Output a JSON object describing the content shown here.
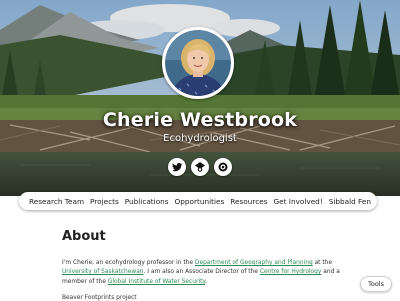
{
  "profile": {
    "name": "Cherie Westbrook",
    "title": "Ecohydrologist"
  },
  "social_links": [
    {
      "icon": "twitter-bird-icon"
    },
    {
      "icon": "google-scholar-icon"
    },
    {
      "icon": "researchgate-icon"
    }
  ],
  "nav": {
    "items": [
      "Research Team",
      "Projects",
      "Publications",
      "Opportunities",
      "Resources",
      "Get Involved!",
      "Sibbald Fen"
    ]
  },
  "about": {
    "heading": "About",
    "intro": "I'm Cherie, an ecohydrology professor in the ",
    "link_department": "Department of Geography and Planning",
    "at_the": " at the ",
    "link_university": "University of Saskatchewan",
    "associate": ". I am also an Associate Director of the ",
    "link_centre": "Centre for Hydrology",
    "member": " and a member of the ",
    "link_gwf": "Global Institute of Water Security",
    "period": ".",
    "next_line": "Beaver Footprints project"
  },
  "tools_button": "Tools",
  "colors": {
    "link": "#2c8c54",
    "nav_bg": "#ffffff",
    "heading": "#222222"
  }
}
